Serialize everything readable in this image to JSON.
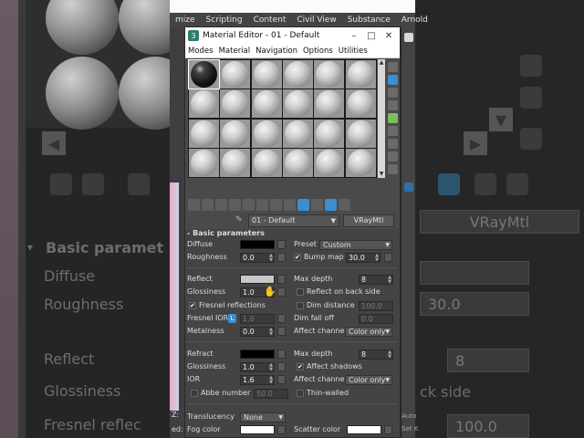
{
  "background": {
    "basic_params_label": "Basic paramet",
    "diffuse": "Diffuse",
    "roughness": "Roughness",
    "roughness_value": "30.0",
    "reflect": "Reflect",
    "glossiness": "Glossiness",
    "reflect_max_depth": "8",
    "back_side": "ck side",
    "fresnel": "Fresnel reflec",
    "value_100": "100.0",
    "vraymtl": "VRayMtl",
    "autodesk_label": "Auto",
    "set_label": "Set K",
    "z_label": "Z:",
    "ed_label": "ed:"
  },
  "max_menu": [
    "mize",
    "Scripting",
    "Content",
    "Civil View",
    "Substance",
    "Arnold"
  ],
  "editor": {
    "title_icon": "3",
    "title": "Material Editor - 01 - Default",
    "window_buttons": {
      "minimize": "–",
      "maximize": "□",
      "close": "✕"
    },
    "menu": [
      "Modes",
      "Material",
      "Navigation",
      "Options",
      "Utilities"
    ],
    "material_name": "01 - Default",
    "material_type": "VRayMtl"
  },
  "basic_params": {
    "header": "Basic parameters",
    "diffuse": {
      "label": "Diffuse",
      "color": "#000000"
    },
    "preset": {
      "label": "Preset",
      "value": "Custom"
    },
    "roughness": {
      "label": "Roughness",
      "value": "0.0"
    },
    "bump_map": {
      "label": "Bump map",
      "value": "30.0",
      "checked": true
    },
    "reflect": {
      "label": "Reflect",
      "color": "#c8c8c8"
    },
    "reflect_max_depth": {
      "label": "Max depth",
      "value": "8"
    },
    "glossiness": {
      "label": "Glossiness",
      "value": "1.0"
    },
    "reflect_back_side": {
      "label": "Reflect on back side",
      "checked": false
    },
    "fresnel": {
      "label": "Fresnel reflections",
      "checked": true
    },
    "dim_distance": {
      "label": "Dim distance",
      "value": "100.0",
      "checked": false
    },
    "fresnel_ior": {
      "label": "Fresnel IOR",
      "lock": "L",
      "value": "1.6"
    },
    "dim_fall_off": {
      "label": "Dim fall off",
      "value": "0.0"
    },
    "metalness": {
      "label": "Metalness",
      "value": "0.0"
    },
    "reflect_affect": {
      "label": "Affect channels",
      "value": "Color only"
    },
    "refract": {
      "label": "Refract",
      "color": "#000000"
    },
    "refract_max_depth": {
      "label": "Max depth",
      "value": "8"
    },
    "refract_glossiness": {
      "label": "Glossiness",
      "value": "1.0"
    },
    "affect_shadows": {
      "label": "Affect shadows",
      "checked": true
    },
    "ior": {
      "label": "IOR",
      "value": "1.6"
    },
    "refract_affect": {
      "label": "Affect channels",
      "value": "Color only"
    },
    "abbe": {
      "label": "Abbe number",
      "value": "50.0",
      "checked": false
    },
    "thin_walled": {
      "label": "Thin-walled",
      "checked": false
    },
    "translucency": {
      "label": "Translucency",
      "value": "None"
    },
    "fog_color": {
      "label": "Fog color",
      "color": "#ffffff"
    },
    "scatter_color": {
      "label": "Scatter color",
      "color": "#ffffff"
    }
  }
}
